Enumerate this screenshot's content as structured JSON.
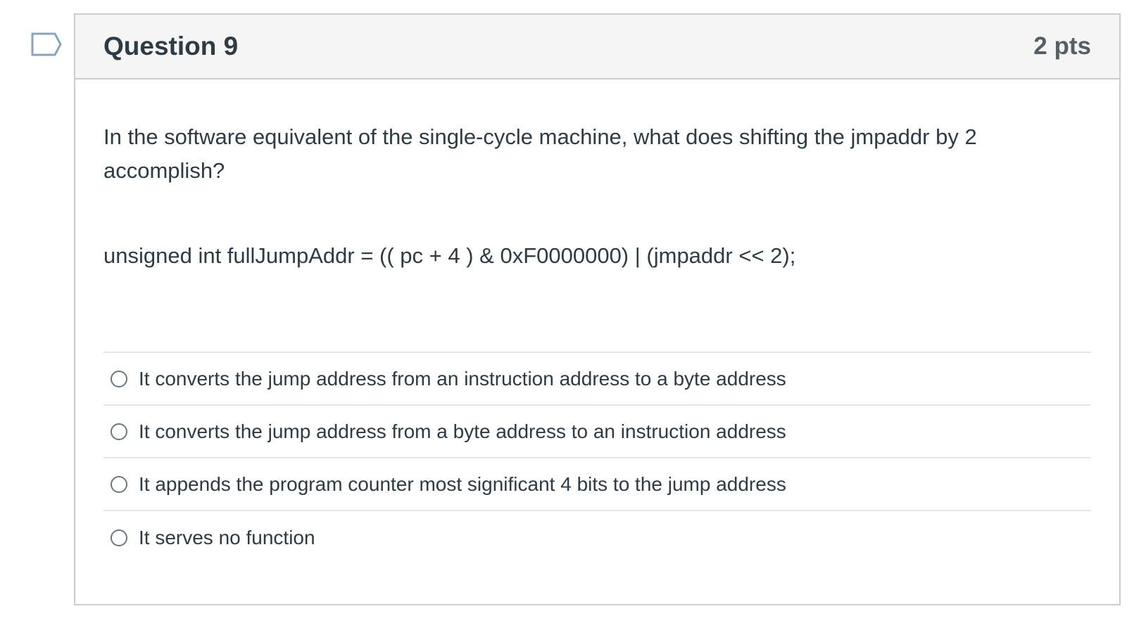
{
  "question": {
    "title": "Question 9",
    "points": "2 pts",
    "text": "In the software equivalent of the single-cycle machine, what does shifting the jmpaddr by 2 accomplish?",
    "code": "unsigned int fullJumpAddr = (( pc + 4 ) & 0xF0000000) | (jmpaddr << 2);",
    "answers": [
      {
        "label": "It converts the jump address from an instruction address to a byte address",
        "selected": false
      },
      {
        "label": "It converts the jump address from a byte address to an instruction address",
        "selected": false
      },
      {
        "label": "It appends the program counter most significant 4 bits to the jump address",
        "selected": false
      },
      {
        "label": "It serves no function",
        "selected": false
      }
    ]
  },
  "icons": {
    "flag": "flag-question-icon",
    "radio": "radio-button-icon"
  },
  "colors": {
    "header_bg": "#f5f5f5",
    "border": "#c7cdd1",
    "text": "#2d3b45",
    "flag_outline": "#8aa4bd"
  }
}
